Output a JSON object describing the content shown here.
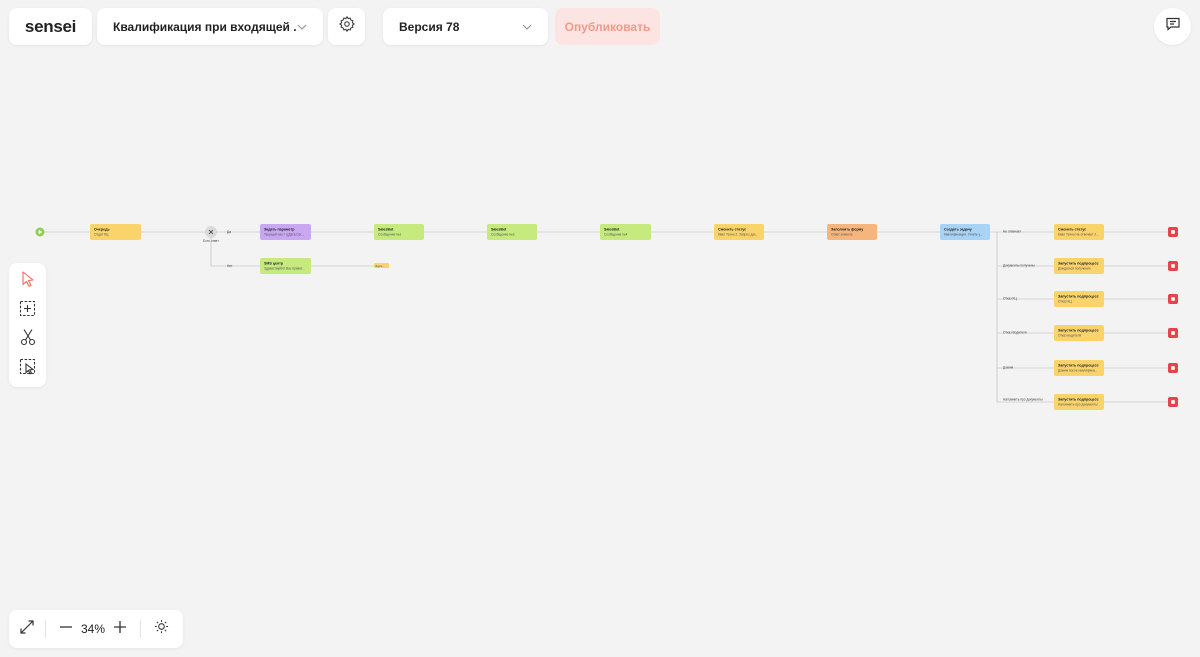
{
  "header": {
    "logo": "sensei",
    "scenario_title": "Квалификация при входящей ...",
    "version_label": "Версия 78",
    "publish_label": "Опубликовать"
  },
  "toolbar": {
    "tools": [
      {
        "name": "pointer-tool",
        "icon": "cursor-icon"
      },
      {
        "name": "add-node-tool",
        "icon": "add-frame-icon"
      },
      {
        "name": "cut-tool",
        "icon": "scissors-icon"
      },
      {
        "name": "area-select-tool",
        "icon": "select-area-icon"
      }
    ]
  },
  "zoom": {
    "level": "34%"
  },
  "flow": {
    "nodes": [
      {
        "id": "queue",
        "title": "Очередь",
        "subtitle": "Отдел КЦ",
        "color": "#fad46b"
      },
      {
        "id": "set_param",
        "title": "Задать параметр",
        "subtitle": "Текущий час = ((Дата.Сег...",
        "color": "#c9a7f3"
      },
      {
        "id": "salesbot1",
        "title": "SalesBot",
        "subtitle": "Сообщение №1",
        "color": "#c6ea7e"
      },
      {
        "id": "salesbot3",
        "title": "SalesBot",
        "subtitle": "Сообщение №3",
        "color": "#c6ea7e"
      },
      {
        "id": "salesbot4",
        "title": "SalesBot",
        "subtitle": "Сообщение №4",
        "color": "#c6ea7e"
      },
      {
        "id": "change_status",
        "title": "Сменить статус",
        "subtitle": "Квал Техно 2. Запрос док...",
        "color": "#fad46b"
      },
      {
        "id": "fill_form",
        "title": "Заполнить форму",
        "subtitle": "Ответ клиента",
        "color": "#f6b57d"
      },
      {
        "id": "create_task",
        "title": "Создать задачу",
        "subtitle": "Квалификация. Узнать у...",
        "color": "#a9d3f5"
      },
      {
        "id": "sms",
        "title": "SMS центр",
        "subtitle": "Здравствуйте! Вас привет...",
        "color": "#c6ea7e"
      },
      {
        "id": "small_tail",
        "title": "",
        "subtitle": "Ждать...",
        "color": "#fad46b"
      },
      {
        "id": "r_status",
        "title": "Сменить статус",
        "subtitle": "Квал Техно Не отвечает л...",
        "color": "#fad46b"
      },
      {
        "id": "r_sub1",
        "title": "Запустить подпроцесс",
        "subtitle": "Дождаться получения",
        "color": "#fad46b"
      },
      {
        "id": "r_sub2",
        "title": "Запустить подпроцесс",
        "subtitle": "Отказ КЦ",
        "color": "#fad46b"
      },
      {
        "id": "r_sub3",
        "title": "Запустить подпроцесс",
        "subtitle": "Отказ водителя",
        "color": "#fad46b"
      },
      {
        "id": "r_sub4",
        "title": "Запустить подпроцесс",
        "subtitle": "Дожим после квалифика...",
        "color": "#fad46b"
      },
      {
        "id": "r_sub5",
        "title": "Запустить подпроцесс",
        "subtitle": "Напомнить про документы",
        "color": "#fad46b"
      }
    ],
    "condition": {
      "label": "Есть ответ",
      "yes": "Да",
      "no": "Нет"
    },
    "branch_labels": [
      "Не отвечает",
      "Документы получены",
      "Отказ КЦ",
      "Отказ Водителя",
      "Дожим",
      "Напомнить про документы"
    ],
    "colors": {
      "start": "#8fd14f",
      "end": "#e8434a",
      "connector": "#b7b7b7",
      "accent": "#f26b5b"
    }
  }
}
